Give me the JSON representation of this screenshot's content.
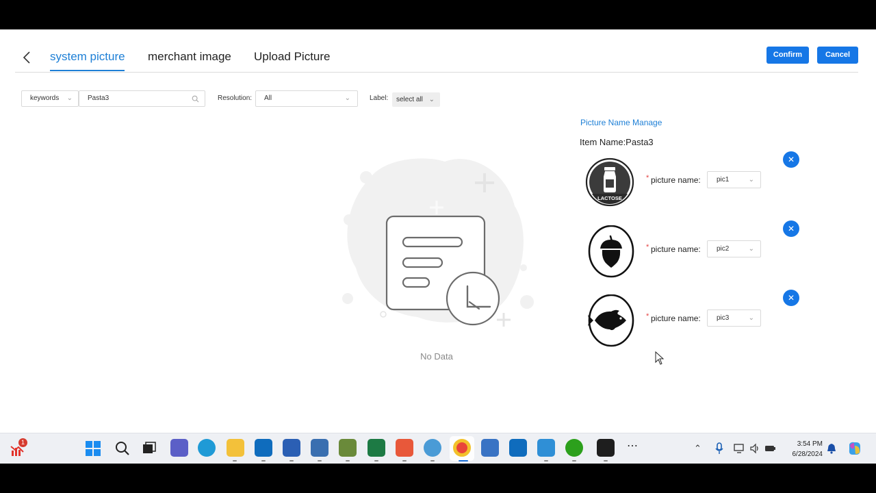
{
  "header": {
    "tabs": [
      {
        "label": "system picture",
        "active": true
      },
      {
        "label": "merchant image",
        "active": false
      },
      {
        "label": "Upload Picture",
        "active": false
      }
    ],
    "confirm_label": "Confirm",
    "cancel_label": "Cancel"
  },
  "filters": {
    "field_select": "keywords",
    "search_value": "Pasta3",
    "resolution_label": "Resolution:",
    "resolution_value": "All",
    "label_label": "Label:",
    "label_value": "select all"
  },
  "empty": {
    "text": "No Data"
  },
  "panel": {
    "title": "Picture Name Manage",
    "item_name": "Item Name:Pasta3",
    "pictures": [
      {
        "icon": "lactose-icon",
        "icon_caption": "LACTOSE",
        "label": "picture name:",
        "value": "pic1"
      },
      {
        "icon": "acorn-icon",
        "label": "picture name:",
        "value": "pic2"
      },
      {
        "icon": "fish-icon",
        "label": "picture name:",
        "value": "pic3"
      }
    ]
  },
  "taskbar": {
    "notification_count": "1",
    "time": "3:54 PM",
    "date": "6/28/2024"
  },
  "colors": {
    "accent": "#1677e6",
    "tab_active": "#1d7fd6",
    "required": "#e54545"
  }
}
